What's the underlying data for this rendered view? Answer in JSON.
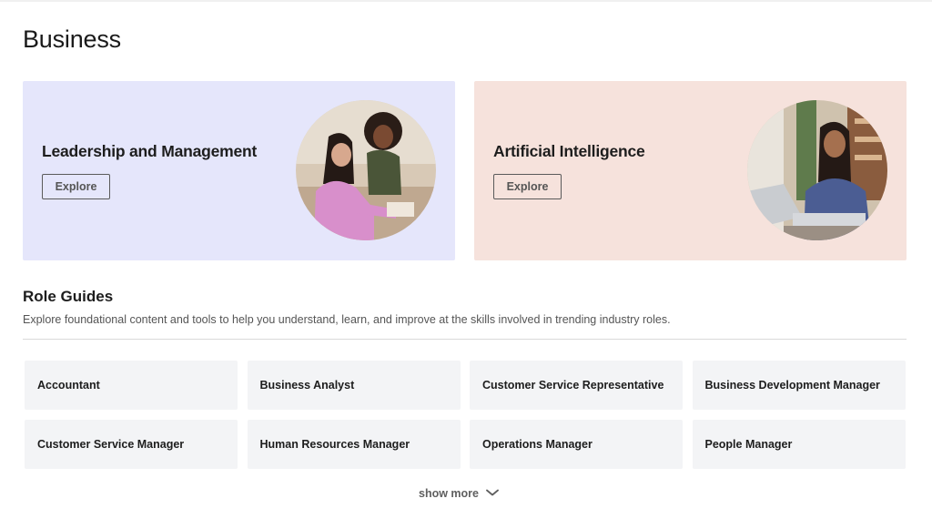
{
  "page": {
    "title": "Business"
  },
  "cards": [
    {
      "title": "Leadership and Management",
      "button": "Explore",
      "bg": "#e5e6fb"
    },
    {
      "title": "Artificial Intelligence",
      "button": "Explore",
      "bg": "#f6e2dc"
    }
  ],
  "role_guides": {
    "title": "Role Guides",
    "description": "Explore foundational content and tools to help you understand, learn, and improve at the skills involved in trending industry roles.",
    "roles": [
      "Accountant",
      "Business Analyst",
      "Customer Service Representative",
      "Business Development Manager",
      "Customer Service Manager",
      "Human Resources Manager",
      "Operations Manager",
      "People Manager"
    ],
    "show_more": "show more"
  },
  "icons": {
    "show_more": "chevron-down-icon"
  }
}
